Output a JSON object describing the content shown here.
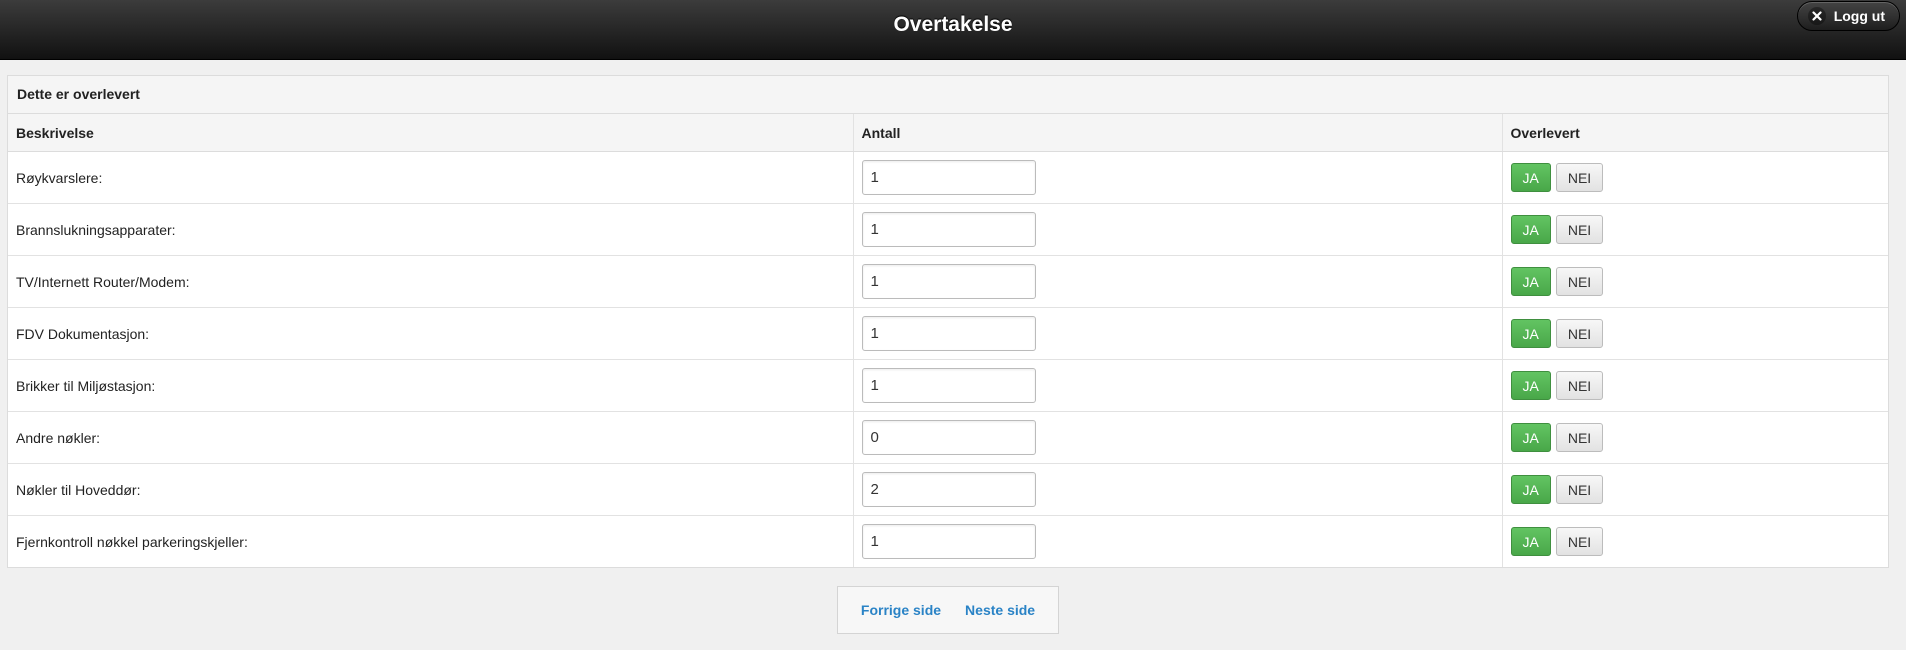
{
  "header": {
    "title": "Overtakelse",
    "logout_label": "Logg ut"
  },
  "panel": {
    "heading": "Dette er overlevert",
    "columns": [
      "Beskrivelse",
      "Antall",
      "Overlevert"
    ],
    "rows": [
      {
        "label": "Røykvarslere:",
        "quantity": "1",
        "yes_label": "JA",
        "no_label": "NEI",
        "selected": "JA"
      },
      {
        "label": "Brannslukningsapparater:",
        "quantity": "1",
        "yes_label": "JA",
        "no_label": "NEI",
        "selected": "JA"
      },
      {
        "label": "TV/Internett Router/Modem:",
        "quantity": "1",
        "yes_label": "JA",
        "no_label": "NEI",
        "selected": "JA"
      },
      {
        "label": "FDV Dokumentasjon:",
        "quantity": "1",
        "yes_label": "JA",
        "no_label": "NEI",
        "selected": "JA"
      },
      {
        "label": "Brikker til Miljøstasjon:",
        "quantity": "1",
        "yes_label": "JA",
        "no_label": "NEI",
        "selected": "JA"
      },
      {
        "label": "Andre nøkler:",
        "quantity": "0",
        "yes_label": "JA",
        "no_label": "NEI",
        "selected": "JA"
      },
      {
        "label": "Nøkler til Hoveddør:",
        "quantity": "2",
        "yes_label": "JA",
        "no_label": "NEI",
        "selected": "JA"
      },
      {
        "label": "Fjernkontroll nøkkel parkeringskjeller:",
        "quantity": "1",
        "yes_label": "JA",
        "no_label": "NEI",
        "selected": "JA"
      }
    ]
  },
  "pager": {
    "prev_label": "Forrige side",
    "next_label": "Neste side"
  },
  "colors": {
    "accent_yes": "#5cb85c",
    "link": "#2a83c6",
    "header_bg": "#1e1e1e"
  },
  "icons": {
    "logout": "close-icon"
  }
}
